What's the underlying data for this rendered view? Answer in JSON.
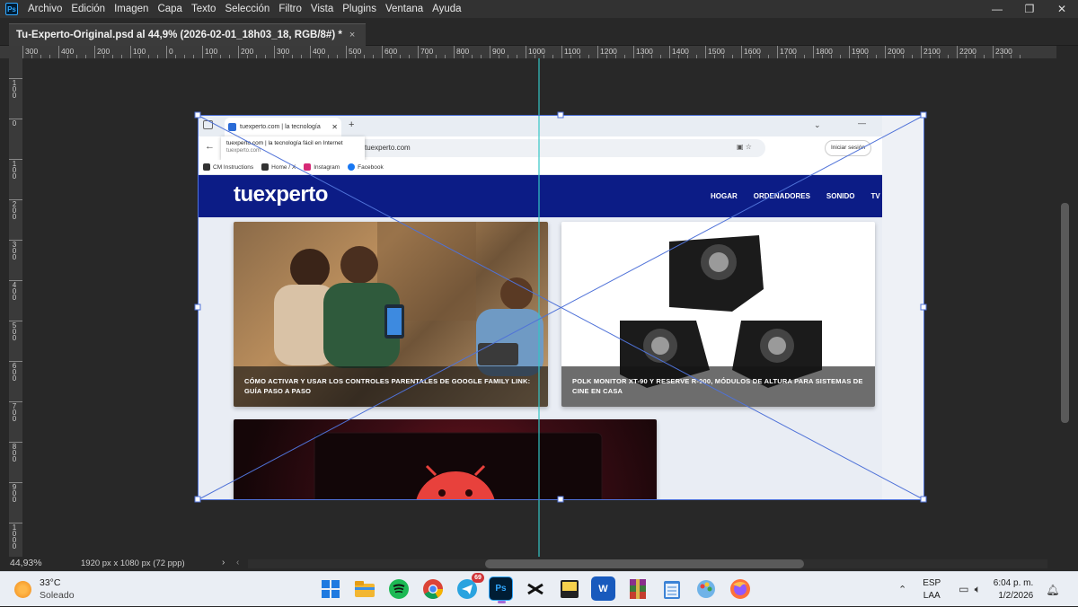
{
  "app": {
    "name": "Photoshop",
    "logo_text": "Ps",
    "menu": [
      "Archivo",
      "Edición",
      "Imagen",
      "Capa",
      "Texto",
      "Selección",
      "Filtro",
      "Vista",
      "Plugins",
      "Ventana",
      "Ayuda"
    ],
    "window_controls": [
      "—",
      "❐",
      "✕"
    ]
  },
  "document_tab": {
    "title": "Tu-Experto-Original.psd al 44,9% (2026-02-01_18h03_18, RGB/8#) *",
    "close": "×"
  },
  "ruler": {
    "h_labels": [
      "300",
      "400",
      "200",
      "100",
      "0",
      "100",
      "200",
      "300",
      "400",
      "500",
      "600",
      "700",
      "800",
      "900",
      "1000",
      "1100",
      "1200",
      "1300",
      "1400",
      "1500",
      "1600",
      "1700",
      "1800",
      "1900",
      "2000",
      "2100",
      "2200",
      "2300"
    ],
    "v_labels": [
      "100",
      "0",
      "100",
      "200",
      "300",
      "400",
      "500",
      "600",
      "700",
      "800",
      "900",
      "1000"
    ]
  },
  "embedded_browser": {
    "tab_title": "tuexperto.com | la tecnología",
    "tab_close": "✕",
    "new_tab": "+",
    "back": "←",
    "address": "tuexperto.com",
    "suggestion_title": "tuexperto.com | la tecnología fácil en Internet",
    "suggestion_url": "tuexperto.com",
    "login": "Iniciar sesión",
    "bookmarks": [
      "CM Instructions",
      "Home / X",
      "Instagram",
      "Facebook"
    ],
    "site_logo": "tuexperto",
    "site_nav": [
      "HOGAR",
      "ORDENADORES",
      "SONIDO",
      "TV"
    ],
    "cards": [
      "CÓMO ACTIVAR Y USAR LOS CONTROLES PARENTALES DE GOOGLE FAMILY LINK: GUÍA PASO A PASO",
      "POLK MONITOR XT-90 Y RESERVE R-900, MÓDULOS DE ALTURA PARA SISTEMAS DE CINE EN CASA"
    ]
  },
  "status_bar": {
    "zoom": "44,93%",
    "doc_info": "1920 px x 1080 px (72 ppp)",
    "arrow": "›",
    "scroll_left": "‹"
  },
  "taskbar": {
    "weather_temp": "33°C",
    "weather_desc": "Soleado",
    "apps": [
      {
        "name": "start",
        "label": ""
      },
      {
        "name": "file-explorer",
        "label": ""
      },
      {
        "name": "spotify",
        "label": ""
      },
      {
        "name": "chrome",
        "label": ""
      },
      {
        "name": "telegram",
        "label": "",
        "badge": "69"
      },
      {
        "name": "photoshop",
        "label": "Ps"
      },
      {
        "name": "capcut",
        "label": ""
      },
      {
        "name": "sticky-notes",
        "label": ""
      },
      {
        "name": "word",
        "label": "W"
      },
      {
        "name": "winrar",
        "label": ""
      },
      {
        "name": "notepad",
        "label": ""
      },
      {
        "name": "paint",
        "label": ""
      },
      {
        "name": "firefox",
        "label": ""
      }
    ],
    "lang_1": "ESP",
    "lang_2": "LAA",
    "time": "6:04 p. m.",
    "date": "1/2/2026"
  },
  "colors": {
    "site_header": "#0c1c86",
    "guide": "#34c6c6",
    "transform": "#4f72d8"
  }
}
